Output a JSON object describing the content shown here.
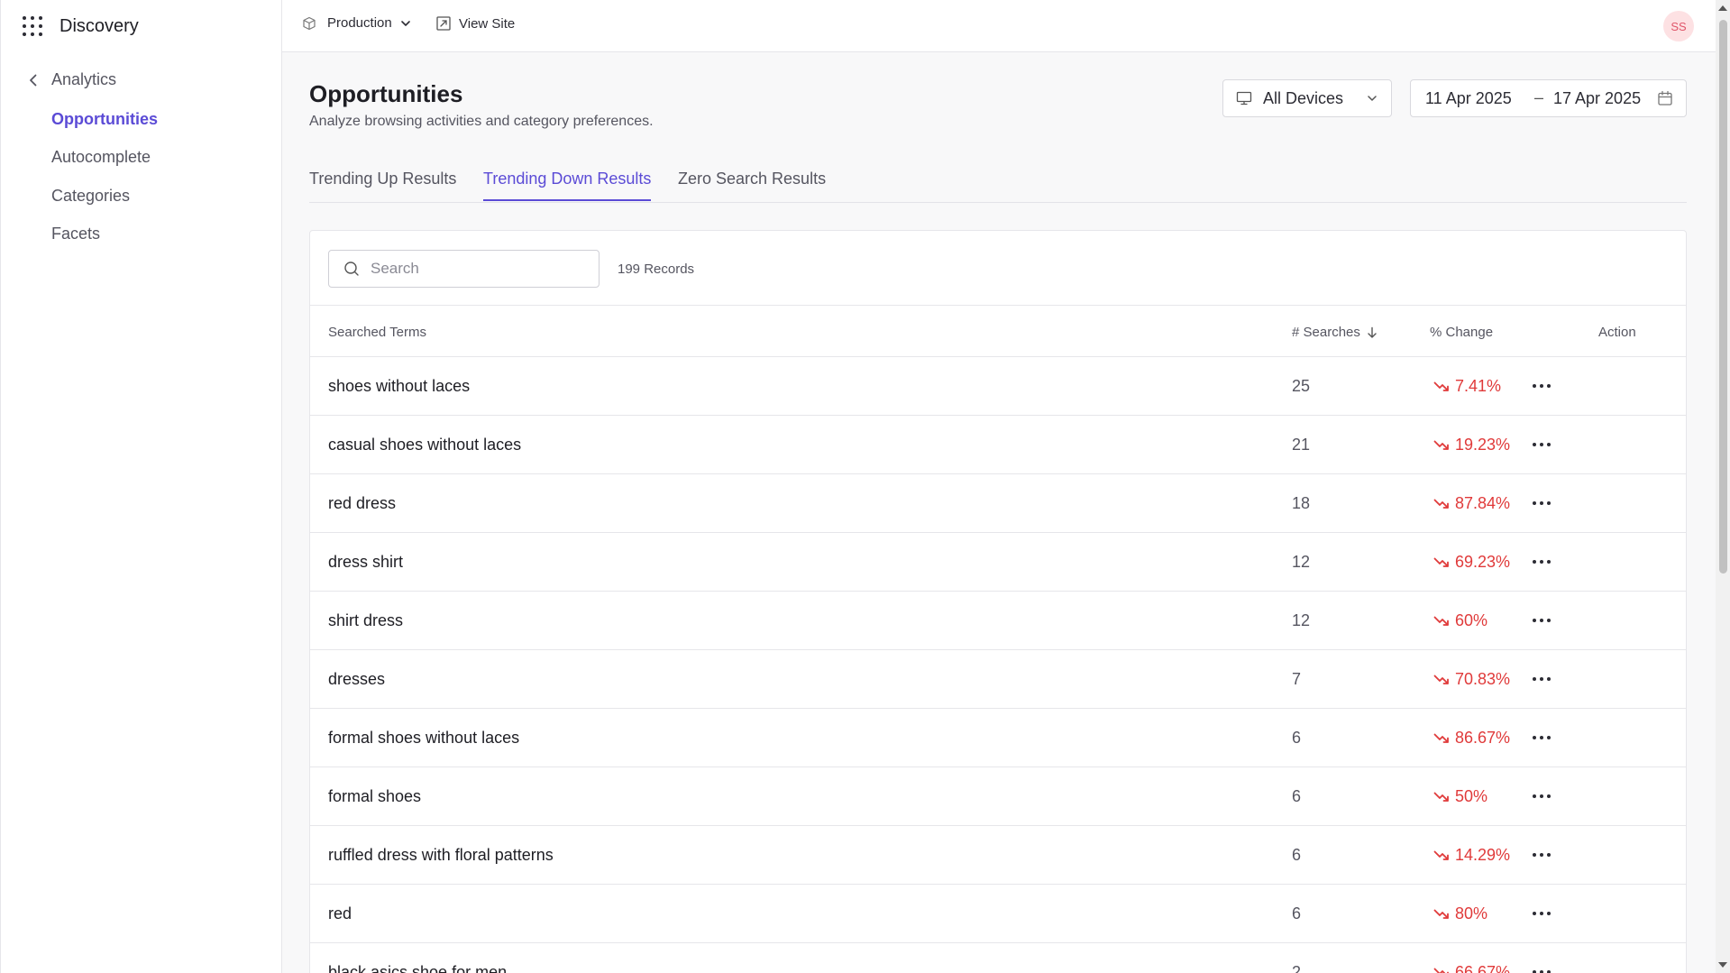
{
  "app": {
    "name": "Discovery"
  },
  "sidebar": {
    "back_label": "Analytics",
    "items": [
      {
        "label": "Opportunities",
        "active": true
      },
      {
        "label": "Autocomplete",
        "active": false
      },
      {
        "label": "Categories",
        "active": false
      },
      {
        "label": "Facets",
        "active": false
      }
    ]
  },
  "topbar": {
    "environment": "Production",
    "view_site": "View Site",
    "avatar_initials": "SS"
  },
  "header": {
    "title": "Opportunities",
    "subtitle": "Analyze browsing activities and category preferences.",
    "device_filter": "All Devices",
    "date_start": "11 Apr 2025",
    "date_separator": "–",
    "date_end": "17 Apr 2025"
  },
  "tabs": [
    {
      "label": "Trending Up Results",
      "active": false
    },
    {
      "label": "Trending Down Results",
      "active": true
    },
    {
      "label": "Zero Search Results",
      "active": false
    }
  ],
  "table": {
    "search_placeholder": "Search",
    "records": "199 Records",
    "columns": {
      "term": "Searched Terms",
      "searches": "# Searches",
      "change": "% Change",
      "action": "Action"
    },
    "rows": [
      {
        "term": "shoes without laces",
        "searches": "25",
        "change": "7.41%"
      },
      {
        "term": "casual shoes without laces",
        "searches": "21",
        "change": "19.23%"
      },
      {
        "term": "red dress",
        "searches": "18",
        "change": "87.84%"
      },
      {
        "term": "dress shirt",
        "searches": "12",
        "change": "69.23%"
      },
      {
        "term": "shirt dress",
        "searches": "12",
        "change": "60%"
      },
      {
        "term": "dresses",
        "searches": "7",
        "change": "70.83%"
      },
      {
        "term": "formal shoes without laces",
        "searches": "6",
        "change": "86.67%"
      },
      {
        "term": "formal shoes",
        "searches": "6",
        "change": "50%"
      },
      {
        "term": "ruffled dress with floral patterns",
        "searches": "6",
        "change": "14.29%"
      },
      {
        "term": "red",
        "searches": "6",
        "change": "80%"
      },
      {
        "term": "black asics shoe for men",
        "searches": "2",
        "change": "66.67%"
      }
    ]
  },
  "colors": {
    "accent": "#5b4bd6",
    "negative": "#e03a3a"
  }
}
